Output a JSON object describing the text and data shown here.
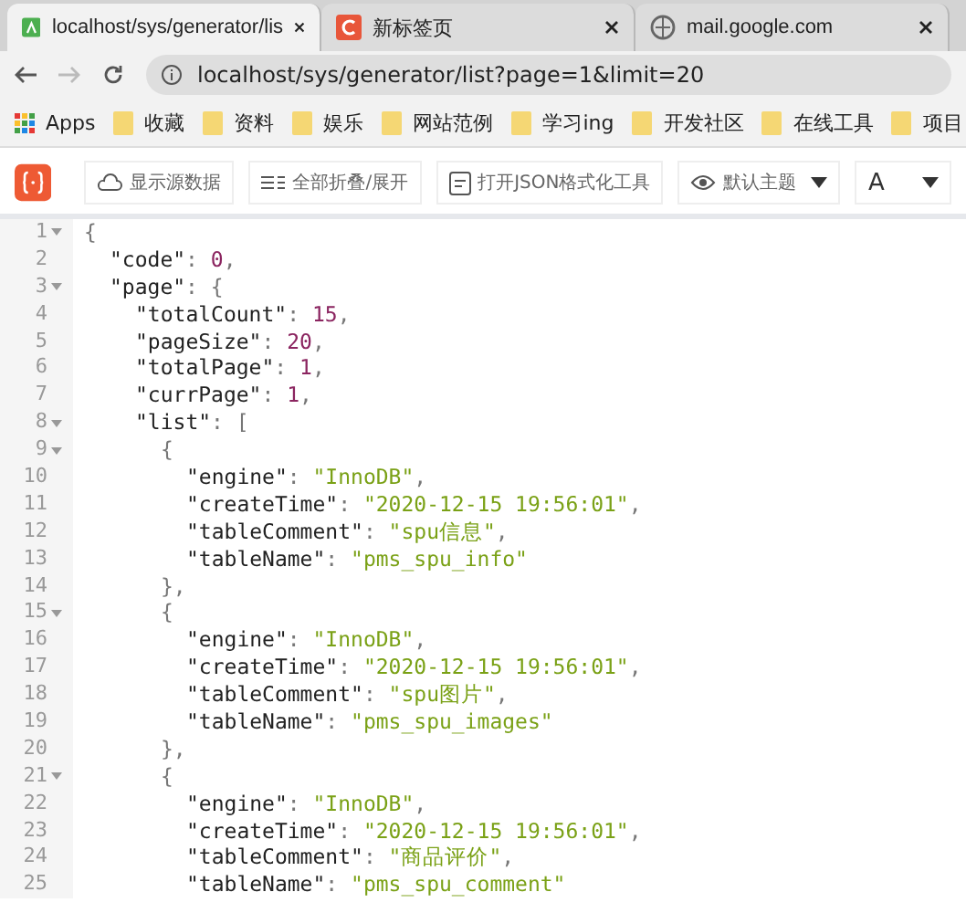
{
  "tabs": [
    {
      "title": "localhost/sys/generator/lis",
      "selected": true
    },
    {
      "title": "新标签页",
      "selected": false
    },
    {
      "title": "mail.google.com",
      "selected": false
    }
  ],
  "address": {
    "url": "localhost/sys/generator/list?page=1&limit=20"
  },
  "bookmarks": {
    "apps": "Apps",
    "items": [
      "收藏",
      "资料",
      "娱乐",
      "网站范例",
      "学习ing",
      "开发社区",
      "在线工具",
      "项目"
    ]
  },
  "toolbar": {
    "buttons": [
      {
        "kind": "cloud",
        "label": "显示源数据"
      },
      {
        "kind": "fold",
        "label": "全部折叠/展开"
      },
      {
        "kind": "tool",
        "label": "打开JSON格式化工具"
      }
    ],
    "selects": [
      {
        "kind": "eye",
        "label": "默认主题"
      },
      {
        "kind": "font",
        "label": "A"
      }
    ]
  },
  "code_lines": [
    {
      "n": "1",
      "fold": true,
      "tokens": [
        {
          "kind": "punct",
          "text": "{"
        }
      ],
      "children": [
        {
          "n": "2",
          "fold": false,
          "tokens": [
            {
              "kind": "key",
              "text": "\"code\""
            },
            {
              "kind": "punct",
              "text": ": "
            },
            {
              "kind": "number",
              "text": "0"
            },
            {
              "kind": "punct",
              "text": ","
            }
          ]
        },
        {
          "n": "3",
          "fold": true,
          "tokens": [
            {
              "kind": "key",
              "text": "\"page\""
            },
            {
              "kind": "punct",
              "text": ": {"
            }
          ],
          "children": [
            {
              "n": "4",
              "fold": false,
              "tokens": [
                {
                  "kind": "key",
                  "text": "\"totalCount\""
                },
                {
                  "kind": "punct",
                  "text": ": "
                },
                {
                  "kind": "number",
                  "text": "15"
                },
                {
                  "kind": "punct",
                  "text": ","
                }
              ]
            },
            {
              "n": "5",
              "fold": false,
              "tokens": [
                {
                  "kind": "key",
                  "text": "\"pageSize\""
                },
                {
                  "kind": "punct",
                  "text": ": "
                },
                {
                  "kind": "number",
                  "text": "20"
                },
                {
                  "kind": "punct",
                  "text": ","
                }
              ]
            },
            {
              "n": "6",
              "fold": false,
              "tokens": [
                {
                  "kind": "key",
                  "text": "\"totalPage\""
                },
                {
                  "kind": "punct",
                  "text": ": "
                },
                {
                  "kind": "number",
                  "text": "1"
                },
                {
                  "kind": "punct",
                  "text": ","
                }
              ]
            },
            {
              "n": "7",
              "fold": false,
              "tokens": [
                {
                  "kind": "key",
                  "text": "\"currPage\""
                },
                {
                  "kind": "punct",
                  "text": ": "
                },
                {
                  "kind": "number",
                  "text": "1"
                },
                {
                  "kind": "punct",
                  "text": ","
                }
              ]
            },
            {
              "n": "8",
              "fold": true,
              "tokens": [
                {
                  "kind": "key",
                  "text": "\"list\""
                },
                {
                  "kind": "punct",
                  "text": ": ["
                }
              ],
              "children": [
                {
                  "n": "9",
                  "fold": true,
                  "tokens": [
                    {
                      "kind": "punct",
                      "text": "{"
                    }
                  ],
                  "children": [
                    {
                      "n": "10",
                      "fold": false,
                      "tokens": [
                        {
                          "kind": "key",
                          "text": "\"engine\""
                        },
                        {
                          "kind": "punct",
                          "text": ": "
                        },
                        {
                          "kind": "string",
                          "text": "\"InnoDB\""
                        },
                        {
                          "kind": "punct",
                          "text": ","
                        }
                      ]
                    },
                    {
                      "n": "11",
                      "fold": false,
                      "tokens": [
                        {
                          "kind": "key",
                          "text": "\"createTime\""
                        },
                        {
                          "kind": "punct",
                          "text": ": "
                        },
                        {
                          "kind": "string",
                          "text": "\"2020-12-15 19:56:01\""
                        },
                        {
                          "kind": "punct",
                          "text": ","
                        }
                      ]
                    },
                    {
                      "n": "12",
                      "fold": false,
                      "tokens": [
                        {
                          "kind": "key",
                          "text": "\"tableComment\""
                        },
                        {
                          "kind": "punct",
                          "text": ": "
                        },
                        {
                          "kind": "string",
                          "text": "\"spu信息\""
                        },
                        {
                          "kind": "punct",
                          "text": ","
                        }
                      ]
                    },
                    {
                      "n": "13",
                      "fold": false,
                      "tokens": [
                        {
                          "kind": "key",
                          "text": "\"tableName\""
                        },
                        {
                          "kind": "punct",
                          "text": ": "
                        },
                        {
                          "kind": "string",
                          "text": "\"pms_spu_info\""
                        }
                      ]
                    }
                  ]
                },
                {
                  "n": "14",
                  "fold": false,
                  "tokens": [
                    {
                      "kind": "punct",
                      "text": "},"
                    }
                  ]
                },
                {
                  "n": "15",
                  "fold": true,
                  "tokens": [
                    {
                      "kind": "punct",
                      "text": "{"
                    }
                  ],
                  "children": [
                    {
                      "n": "16",
                      "fold": false,
                      "tokens": [
                        {
                          "kind": "key",
                          "text": "\"engine\""
                        },
                        {
                          "kind": "punct",
                          "text": ": "
                        },
                        {
                          "kind": "string",
                          "text": "\"InnoDB\""
                        },
                        {
                          "kind": "punct",
                          "text": ","
                        }
                      ]
                    },
                    {
                      "n": "17",
                      "fold": false,
                      "tokens": [
                        {
                          "kind": "key",
                          "text": "\"createTime\""
                        },
                        {
                          "kind": "punct",
                          "text": ": "
                        },
                        {
                          "kind": "string",
                          "text": "\"2020-12-15 19:56:01\""
                        },
                        {
                          "kind": "punct",
                          "text": ","
                        }
                      ]
                    },
                    {
                      "n": "18",
                      "fold": false,
                      "tokens": [
                        {
                          "kind": "key",
                          "text": "\"tableComment\""
                        },
                        {
                          "kind": "punct",
                          "text": ": "
                        },
                        {
                          "kind": "string",
                          "text": "\"spu图片\""
                        },
                        {
                          "kind": "punct",
                          "text": ","
                        }
                      ]
                    },
                    {
                      "n": "19",
                      "fold": false,
                      "tokens": [
                        {
                          "kind": "key",
                          "text": "\"tableName\""
                        },
                        {
                          "kind": "punct",
                          "text": ": "
                        },
                        {
                          "kind": "string",
                          "text": "\"pms_spu_images\""
                        }
                      ]
                    }
                  ]
                },
                {
                  "n": "20",
                  "fold": false,
                  "tokens": [
                    {
                      "kind": "punct",
                      "text": "},"
                    }
                  ]
                },
                {
                  "n": "21",
                  "fold": true,
                  "tokens": [
                    {
                      "kind": "punct",
                      "text": "{"
                    }
                  ],
                  "children": [
                    {
                      "n": "22",
                      "fold": false,
                      "tokens": [
                        {
                          "kind": "key",
                          "text": "\"engine\""
                        },
                        {
                          "kind": "punct",
                          "text": ": "
                        },
                        {
                          "kind": "string",
                          "text": "\"InnoDB\""
                        },
                        {
                          "kind": "punct",
                          "text": ","
                        }
                      ]
                    },
                    {
                      "n": "23",
                      "fold": false,
                      "tokens": [
                        {
                          "kind": "key",
                          "text": "\"createTime\""
                        },
                        {
                          "kind": "punct",
                          "text": ": "
                        },
                        {
                          "kind": "string",
                          "text": "\"2020-12-15 19:56:01\""
                        },
                        {
                          "kind": "punct",
                          "text": ","
                        }
                      ]
                    },
                    {
                      "n": "24",
                      "fold": false,
                      "tokens": [
                        {
                          "kind": "key",
                          "text": "\"tableComment\""
                        },
                        {
                          "kind": "punct",
                          "text": ": "
                        },
                        {
                          "kind": "string",
                          "text": "\"商品评价\""
                        },
                        {
                          "kind": "punct",
                          "text": ","
                        }
                      ]
                    },
                    {
                      "n": "25",
                      "fold": false,
                      "tokens": [
                        {
                          "kind": "key",
                          "text": "\"tableName\""
                        },
                        {
                          "kind": "punct",
                          "text": ": "
                        },
                        {
                          "kind": "string",
                          "text": "\"pms_spu_comment\""
                        }
                      ]
                    }
                  ]
                }
              ]
            }
          ]
        }
      ]
    }
  ]
}
